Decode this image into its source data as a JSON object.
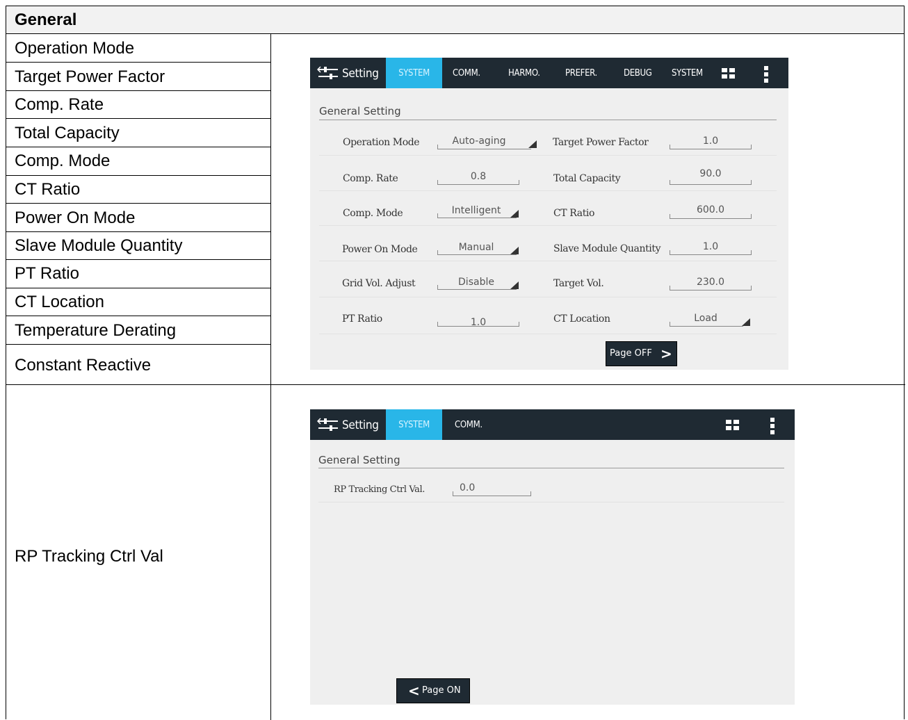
{
  "header": {
    "title": "General"
  },
  "left_labels": [
    "Operation Mode",
    "Target Power Factor",
    "Comp. Rate",
    "Total Capacity",
    "Comp. Mode",
    "CT Ratio",
    "Power On Mode",
    "Slave Module Quantity",
    "PT Ratio",
    "CT Location",
    "Temperature Derating",
    "Constant Reactive"
  ],
  "second_row_label": "RP Tracking Ctrl Val",
  "screen1": {
    "tabs": [
      "Setting",
      "SYSTEM",
      "COMM.",
      "HARMO.",
      "PREFER.",
      "DEBUG",
      "SYSTEM"
    ],
    "section_title": "General Setting",
    "fields": [
      {
        "label": "Operation Mode",
        "value": "Auto-aging",
        "dropdown": true
      },
      {
        "label": "Target Power Factor",
        "value": "1.0",
        "dropdown": false
      },
      {
        "label": "Comp. Rate",
        "value": "0.8",
        "dropdown": false
      },
      {
        "label": "Total Capacity",
        "value": "90.0",
        "dropdown": false
      },
      {
        "label": "Comp. Mode",
        "value": "Intelligent",
        "dropdown": true
      },
      {
        "label": "CT Ratio",
        "value": "600.0",
        "dropdown": false
      },
      {
        "label": "Power On Mode",
        "value": "Manual",
        "dropdown": true
      },
      {
        "label": "Slave Module Quantity",
        "value": "1.0",
        "dropdown": false
      },
      {
        "label": "Grid Vol. Adjust",
        "value": "Disable",
        "dropdown": true
      },
      {
        "label": "Target Vol.",
        "value": "230.0",
        "dropdown": false
      },
      {
        "label": "PT Ratio",
        "value": "1.0",
        "dropdown": false
      },
      {
        "label": "CT Location",
        "value": "Load",
        "dropdown": true
      }
    ],
    "page_button": "Page OFF",
    "page_button_arrow": ">"
  },
  "screen2": {
    "tabs": [
      "Setting",
      "SYSTEM",
      "COMM."
    ],
    "section_title": "General Setting",
    "fields": [
      {
        "label": "RP Tracking Ctrl Val.",
        "value": "0.0"
      }
    ],
    "page_button": "Page ON",
    "page_button_arrow": "<"
  },
  "colors": {
    "topbar": "#1f2a33",
    "active_tab": "#29b6e8",
    "screen_bg": "#efefef",
    "header_bg": "#f2f2f2"
  }
}
